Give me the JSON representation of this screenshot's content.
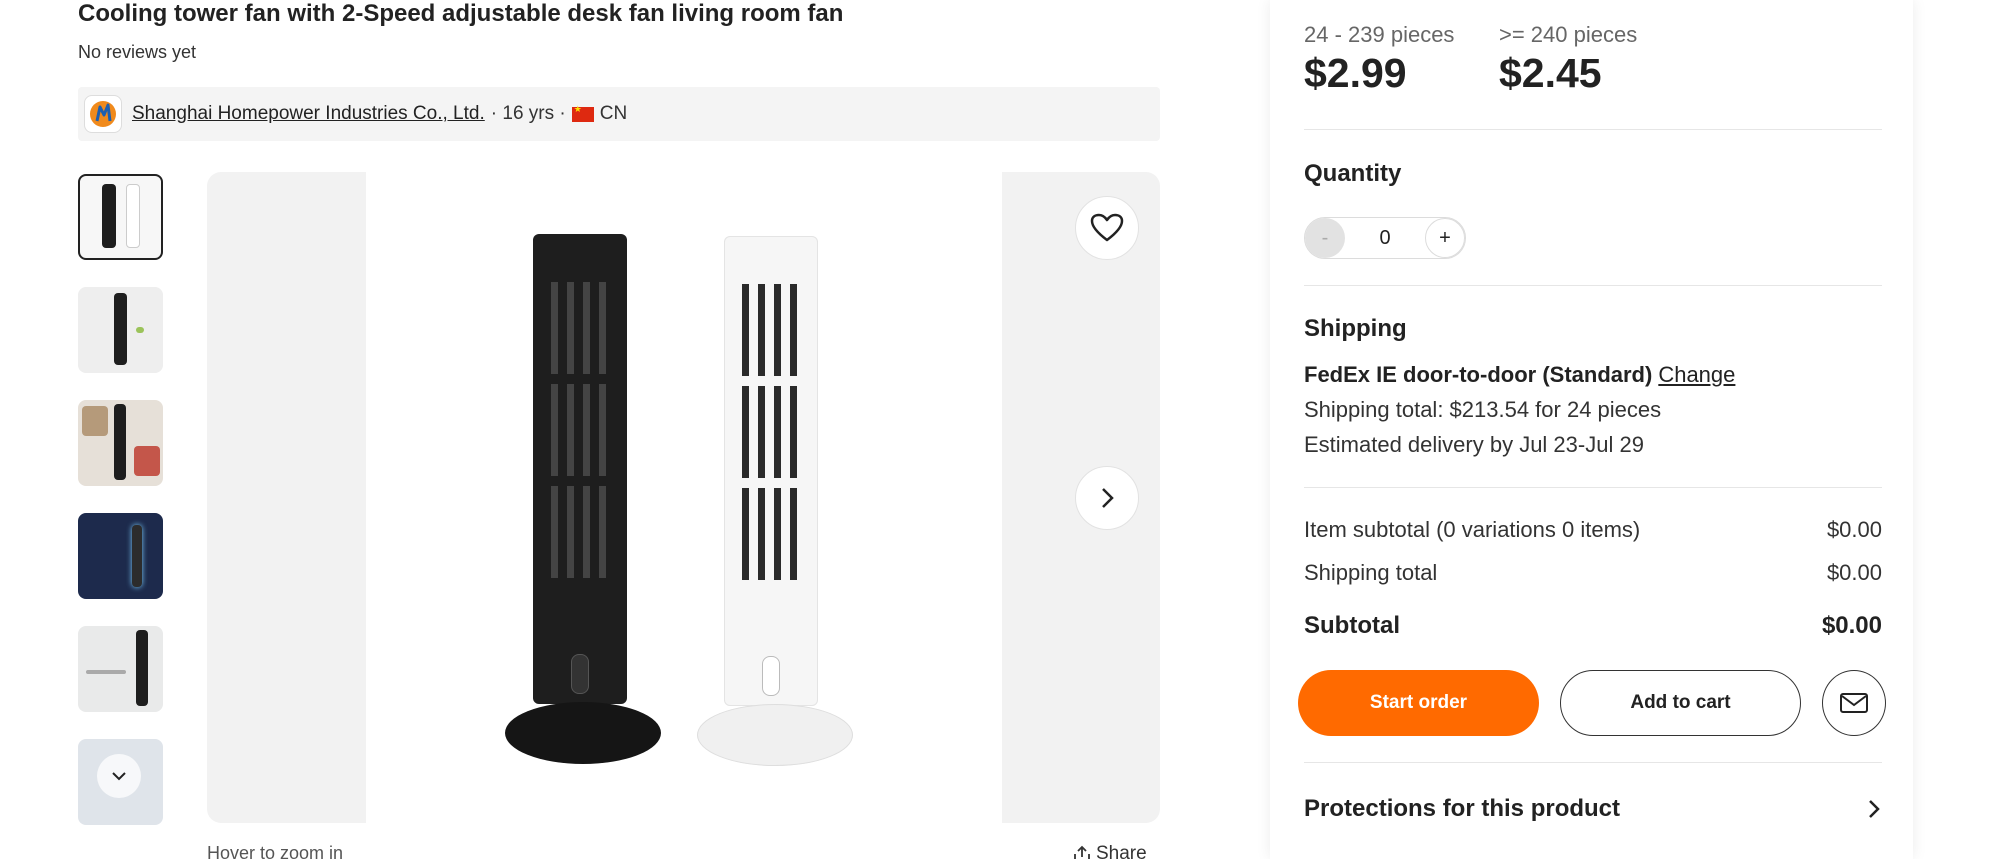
{
  "product": {
    "title": "Cooling tower fan with 2-Speed adjustable desk fan living room fan",
    "reviews": "No reviews yet"
  },
  "supplier": {
    "name": "Shanghai Homepower Industries Co., Ltd.",
    "years": "· 16 yrs ·",
    "country": "CN"
  },
  "gallery": {
    "hover_hint": "Hover to zoom in",
    "share_label": "Share"
  },
  "pricing": {
    "tiers": [
      {
        "range": "24 - 239 pieces",
        "price": "$2.99"
      },
      {
        "range": ">= 240 pieces",
        "price": "$2.45"
      }
    ]
  },
  "quantity": {
    "title": "Quantity",
    "minus": "-",
    "value": "0",
    "plus": "+"
  },
  "shipping": {
    "title": "Shipping",
    "method": "FedEx IE door-to-door (Standard)",
    "change_label": "Change",
    "total_line": "Shipping total: $213.54 for 24 pieces",
    "delivery_line": "Estimated delivery by Jul 23-Jul 29"
  },
  "summary": {
    "item_subtotal_label": "Item subtotal (0 variations 0 items)",
    "item_subtotal_value": "$0.00",
    "shipping_total_label": "Shipping total",
    "shipping_total_value": "$0.00",
    "subtotal_label": "Subtotal",
    "subtotal_value": "$0.00"
  },
  "actions": {
    "start_order": "Start order",
    "add_to_cart": "Add to cart"
  },
  "protections": {
    "title": "Protections for this product"
  },
  "colors": {
    "accent": "#ff6a00",
    "text": "#222222",
    "panel_bg": "#f4f4f4"
  }
}
